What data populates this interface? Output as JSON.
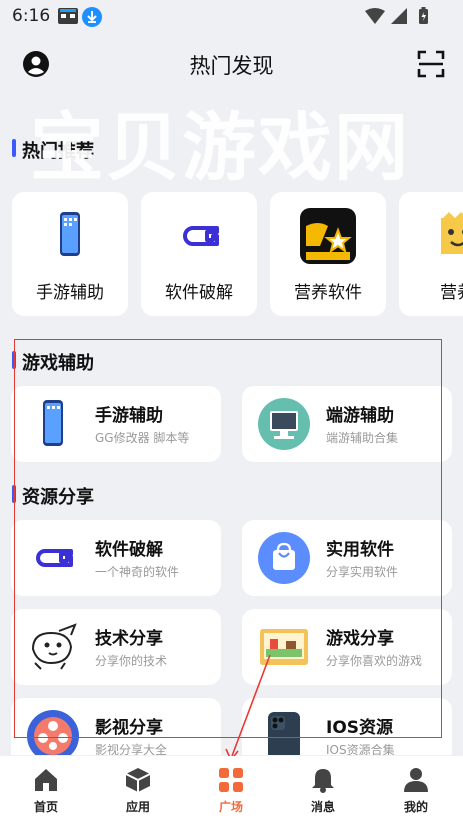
{
  "status_bar": {
    "time": "6:16",
    "app_icon1": "magic-app-icon",
    "app_icon2": "download-icon"
  },
  "header": {
    "title": "热门发现",
    "left_icon": "user-avatar-icon",
    "right_icon": "scan-icon"
  },
  "watermark": "宝贝游戏网",
  "recommend": {
    "title": "热门推荐",
    "items": [
      {
        "label": "手游辅助",
        "icon": "phone-icon"
      },
      {
        "label": "软件破解",
        "icon": "key-icon"
      },
      {
        "label": "营养软件",
        "icon": "star-app-icon"
      },
      {
        "label": "营养",
        "icon": "face-icon"
      }
    ]
  },
  "game_assist": {
    "title": "游戏辅助",
    "items": [
      {
        "title": "手游辅助",
        "subtitle": "GG修改器 脚本等",
        "icon": "phone-icon"
      },
      {
        "title": "端游辅助",
        "subtitle": "端游辅助合集",
        "icon": "monitor-icon"
      }
    ]
  },
  "resource_share": {
    "title": "资源分享",
    "items": [
      {
        "title": "软件破解",
        "subtitle": "一个神奇的软件",
        "icon": "key-icon"
      },
      {
        "title": "实用软件",
        "subtitle": "分享实用软件",
        "icon": "shopping-bag-icon"
      },
      {
        "title": "技术分享",
        "subtitle": "分享你的技术",
        "icon": "bird-icon"
      },
      {
        "title": "游戏分享",
        "subtitle": "分享你喜欢的游戏",
        "icon": "game-screen-icon"
      },
      {
        "title": "影视分享",
        "subtitle": "影视分享大全",
        "icon": "film-reel-icon"
      },
      {
        "title": "IOS资源",
        "subtitle": "IOS资源合集",
        "icon": "iphone-icon"
      }
    ]
  },
  "tabbar": {
    "active_color": "#f26a3a",
    "items": [
      {
        "label": "首页",
        "icon": "home-icon"
      },
      {
        "label": "应用",
        "icon": "cube-icon"
      },
      {
        "label": "广场",
        "icon": "grid-icon"
      },
      {
        "label": "消息",
        "icon": "bell-icon"
      },
      {
        "label": "我的",
        "icon": "person-icon"
      }
    ]
  }
}
